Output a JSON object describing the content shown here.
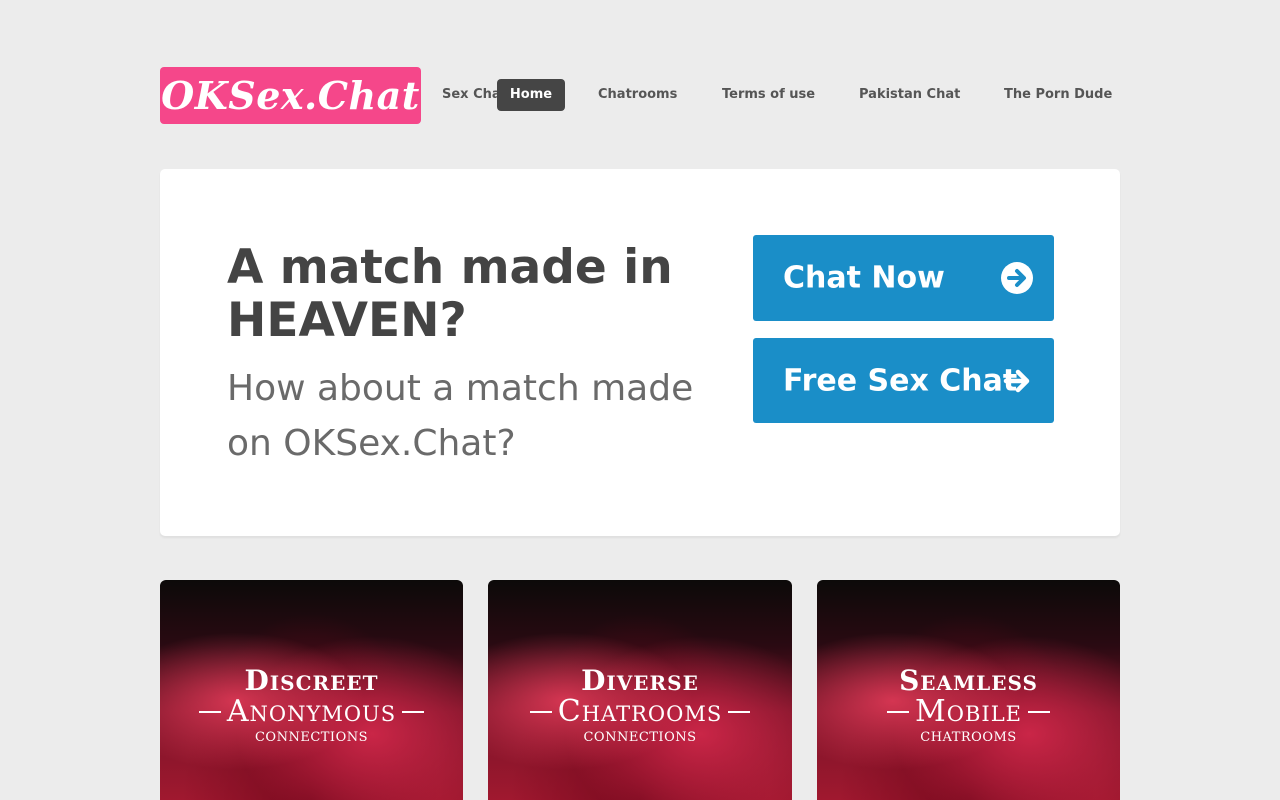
{
  "header": {
    "logo_text": "OKSex.Chat",
    "nav": [
      {
        "label": "Sex Chat"
      },
      {
        "label": "Home"
      },
      {
        "label": "Chatrooms"
      },
      {
        "label": "Terms of use"
      },
      {
        "label": "Pakistan Chat"
      },
      {
        "label": "The Porn Dude"
      }
    ]
  },
  "hero": {
    "title": "A match made in HEAVEN?",
    "subtitle": "How about a match made on OKSex.Chat?",
    "cta_chat_now": "Chat Now",
    "cta_free_sex_chat": "Free Sex Chat"
  },
  "tiles": [
    {
      "line1": "Discreet",
      "line2": "Anonymous",
      "line3": "connections"
    },
    {
      "line1": "Diverse",
      "line2": "Chatrooms",
      "line3": "connections"
    },
    {
      "line1": "Seamless",
      "line2": "Mobile",
      "line3": "chatrooms"
    }
  ],
  "colors": {
    "logo_bg": "#f5478a",
    "cta_bg": "#1a8ec8",
    "nav_active_bg": "#454545",
    "page_bg": "#ececec"
  },
  "icons": {
    "cta_icon": "arrow-right-circle-icon"
  }
}
